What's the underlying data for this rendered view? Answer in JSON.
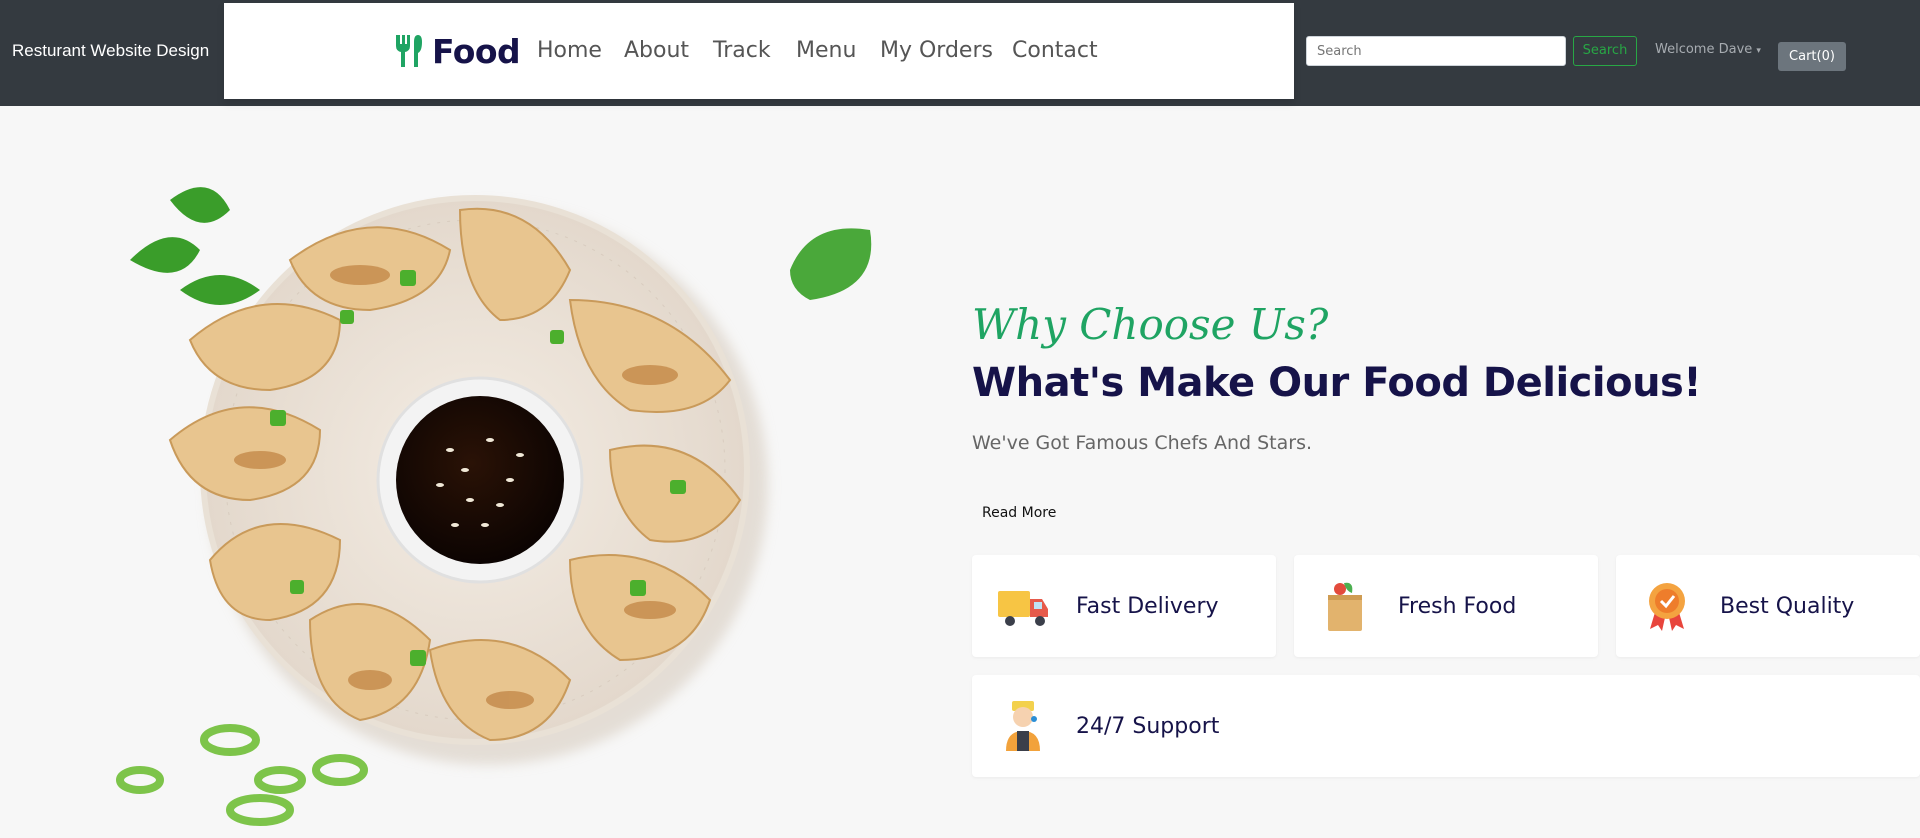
{
  "header": {
    "site_title": "Resturant Website Design",
    "logo_text": "Food",
    "nav": [
      "Home",
      "About",
      "Track",
      "Menu",
      "My Orders",
      "Contact"
    ],
    "search_placeholder": "Search",
    "search_button": "Search",
    "welcome": "Welcome Dave",
    "cart": "Cart(0)"
  },
  "hero": {
    "subtitle": "Why Choose Us?",
    "headline": "What's Make Our Food Delicious!",
    "tagline": "We've Got Famous Chefs And Stars.",
    "read_more": "Read More"
  },
  "features": [
    {
      "label": "Fast Delivery",
      "icon": "delivery-truck-icon"
    },
    {
      "label": "Fresh Food",
      "icon": "grocery-bag-icon"
    },
    {
      "label": "Best Quality",
      "icon": "quality-badge-icon"
    },
    {
      "label": "24/7 Support",
      "icon": "support-agent-icon"
    }
  ],
  "colors": {
    "topbar": "#343a40",
    "accent": "#1fa463",
    "heading": "#161349",
    "background": "#f7f7f7"
  }
}
